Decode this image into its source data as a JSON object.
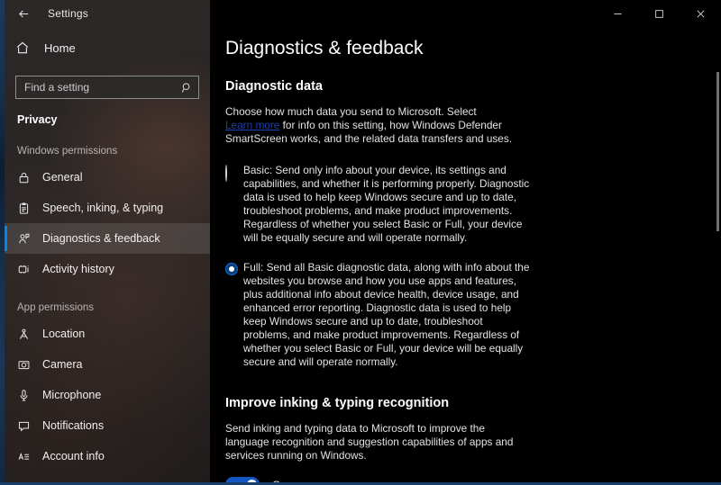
{
  "window": {
    "title": "Settings",
    "back_icon": "back-arrow-icon",
    "minimize_label": "─",
    "maximize_label": "☐",
    "close_label": "✕"
  },
  "sidebar": {
    "home_label": "Home",
    "home_icon": "home-icon",
    "search": {
      "placeholder": "Find a setting",
      "value": "",
      "icon": "search-icon"
    },
    "category": "Privacy",
    "groups": [
      {
        "header": "Windows permissions",
        "items": [
          {
            "label": "General",
            "icon": "lock-icon",
            "selected": false
          },
          {
            "label": "Speech, inking, & typing",
            "icon": "clipboard-icon",
            "selected": false
          },
          {
            "label": "Diagnostics & feedback",
            "icon": "feedback-person-icon",
            "selected": true
          },
          {
            "label": "Activity history",
            "icon": "activity-history-icon",
            "selected": false
          }
        ]
      },
      {
        "header": "App permissions",
        "items": [
          {
            "label": "Location",
            "icon": "location-person-icon",
            "selected": false
          },
          {
            "label": "Camera",
            "icon": "camera-icon",
            "selected": false
          },
          {
            "label": "Microphone",
            "icon": "microphone-icon",
            "selected": false
          },
          {
            "label": "Notifications",
            "icon": "notification-balloon-icon",
            "selected": false
          },
          {
            "label": "Account info",
            "icon": "account-info-icon",
            "selected": false
          }
        ]
      }
    ]
  },
  "main": {
    "page_title": "Diagnostics & feedback",
    "diagnostic_data": {
      "section_title": "Diagnostic data",
      "description_before_link": "Choose how much data you send to Microsoft. Select ",
      "link_text": "Learn more",
      "description_after_link": " for info on this setting, how Windows Defender SmartScreen works, and the related data transfers and uses.",
      "options": [
        {
          "id": "basic",
          "selected": false,
          "text": "Basic: Send only info about your device, its settings and capabilities, and whether it is performing properly. Diagnostic data is used to help keep Windows secure and up to date, troubleshoot problems, and make product improvements. Regardless of whether you select Basic or Full, your device will be equally secure and will operate normally."
        },
        {
          "id": "full",
          "selected": true,
          "text": "Full: Send all Basic diagnostic data, along with info about the websites you browse and how you use apps and features, plus additional info about device health, device usage, and enhanced error reporting. Diagnostic data is used to help keep Windows secure and up to date, troubleshoot problems, and make product improvements. Regardless of whether you select Basic or Full, your device will be equally secure and will operate normally."
        }
      ]
    },
    "inking_typing": {
      "section_title": "Improve inking & typing recognition",
      "description": "Send inking and typing data to Microsoft to improve the language recognition and suggestion capabilities of apps and services running on Windows.",
      "toggle_state_label": "On",
      "toggle_on": true
    }
  },
  "colors": {
    "accent": "#0a84e0",
    "toggle_on": "#1357c4",
    "link": "#1f3fa8",
    "content_bg": "#000000",
    "sidebar_bg": "#2a2625"
  }
}
